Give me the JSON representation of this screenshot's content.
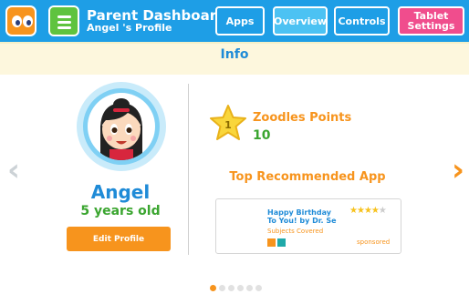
{
  "header": {
    "title": "Parent Dashboard",
    "subtitle": "Angel 's Profile",
    "nav": {
      "apps": "Apps",
      "overview": "Overview",
      "controls": "Controls",
      "tablet_settings": "Tablet Settings"
    }
  },
  "section": {
    "title": "Info"
  },
  "profile": {
    "name": "Angel",
    "age": "5 years old",
    "edit_label": "Edit Profile"
  },
  "points": {
    "level": "1",
    "label": "Zoodles Points",
    "value": "10"
  },
  "recommended": {
    "heading": "Top Recommended App",
    "app": {
      "title_line1": "Happy Birthday",
      "title_line2": "To You! by Dr. Se",
      "subjects_label": "Subjects Covered",
      "rating_stars": 4,
      "rating_max": 5,
      "sponsored": "sponsored"
    }
  },
  "pagination": {
    "total": 6,
    "current": 1
  },
  "colors": {
    "topbar": "#1e9ee6",
    "overview_active": "#4cc2f3",
    "tablet_settings": "#f04d8d",
    "orange": "#f7941d",
    "green": "#3aa52f",
    "blue_text": "#1f8bd7"
  }
}
